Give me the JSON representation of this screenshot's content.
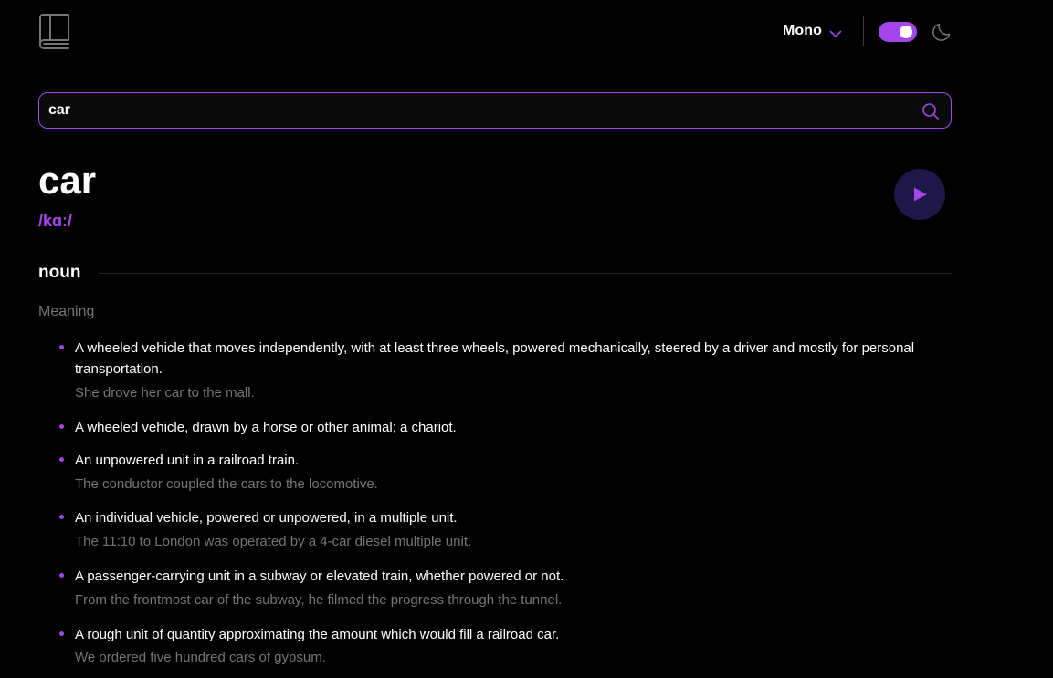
{
  "header": {
    "font_label": "Mono",
    "theme_toggle_on": true
  },
  "search": {
    "value": "car"
  },
  "entry": {
    "word": "car",
    "phonetic": "/kɑː/",
    "part_of_speech": "noun",
    "meaning_heading": "Meaning",
    "definitions": [
      {
        "text": "A wheeled vehicle that moves independently, with at least three wheels, powered mechanically, steered by a driver and mostly for personal transportation.",
        "example": "She drove her car to the mall."
      },
      {
        "text": "A wheeled vehicle, drawn by a horse or other animal; a chariot.",
        "example": ""
      },
      {
        "text": "An unpowered unit in a railroad train.",
        "example": "The conductor coupled the cars to the locomotive."
      },
      {
        "text": "An individual vehicle, powered or unpowered, in a multiple unit.",
        "example": "The 11:10 to London was operated by a 4-car diesel multiple unit."
      },
      {
        "text": "A passenger-carrying unit in a subway or elevated train, whether powered or not.",
        "example": "From the frontmost car of the subway, he filmed the progress through the tunnel."
      },
      {
        "text": "A rough unit of quantity approximating the amount which would fill a railroad car.",
        "example": "We ordered five hundred cars of gypsum."
      }
    ]
  },
  "colors": {
    "accent": "#a445ed",
    "background": "#000000",
    "muted_text": "#757575",
    "play_button_bg": "#1e1748"
  },
  "icons": {
    "logo": "book-icon",
    "font_dropdown": "chevron-down-icon",
    "theme": "moon-icon",
    "search": "search-icon",
    "play": "play-icon"
  }
}
